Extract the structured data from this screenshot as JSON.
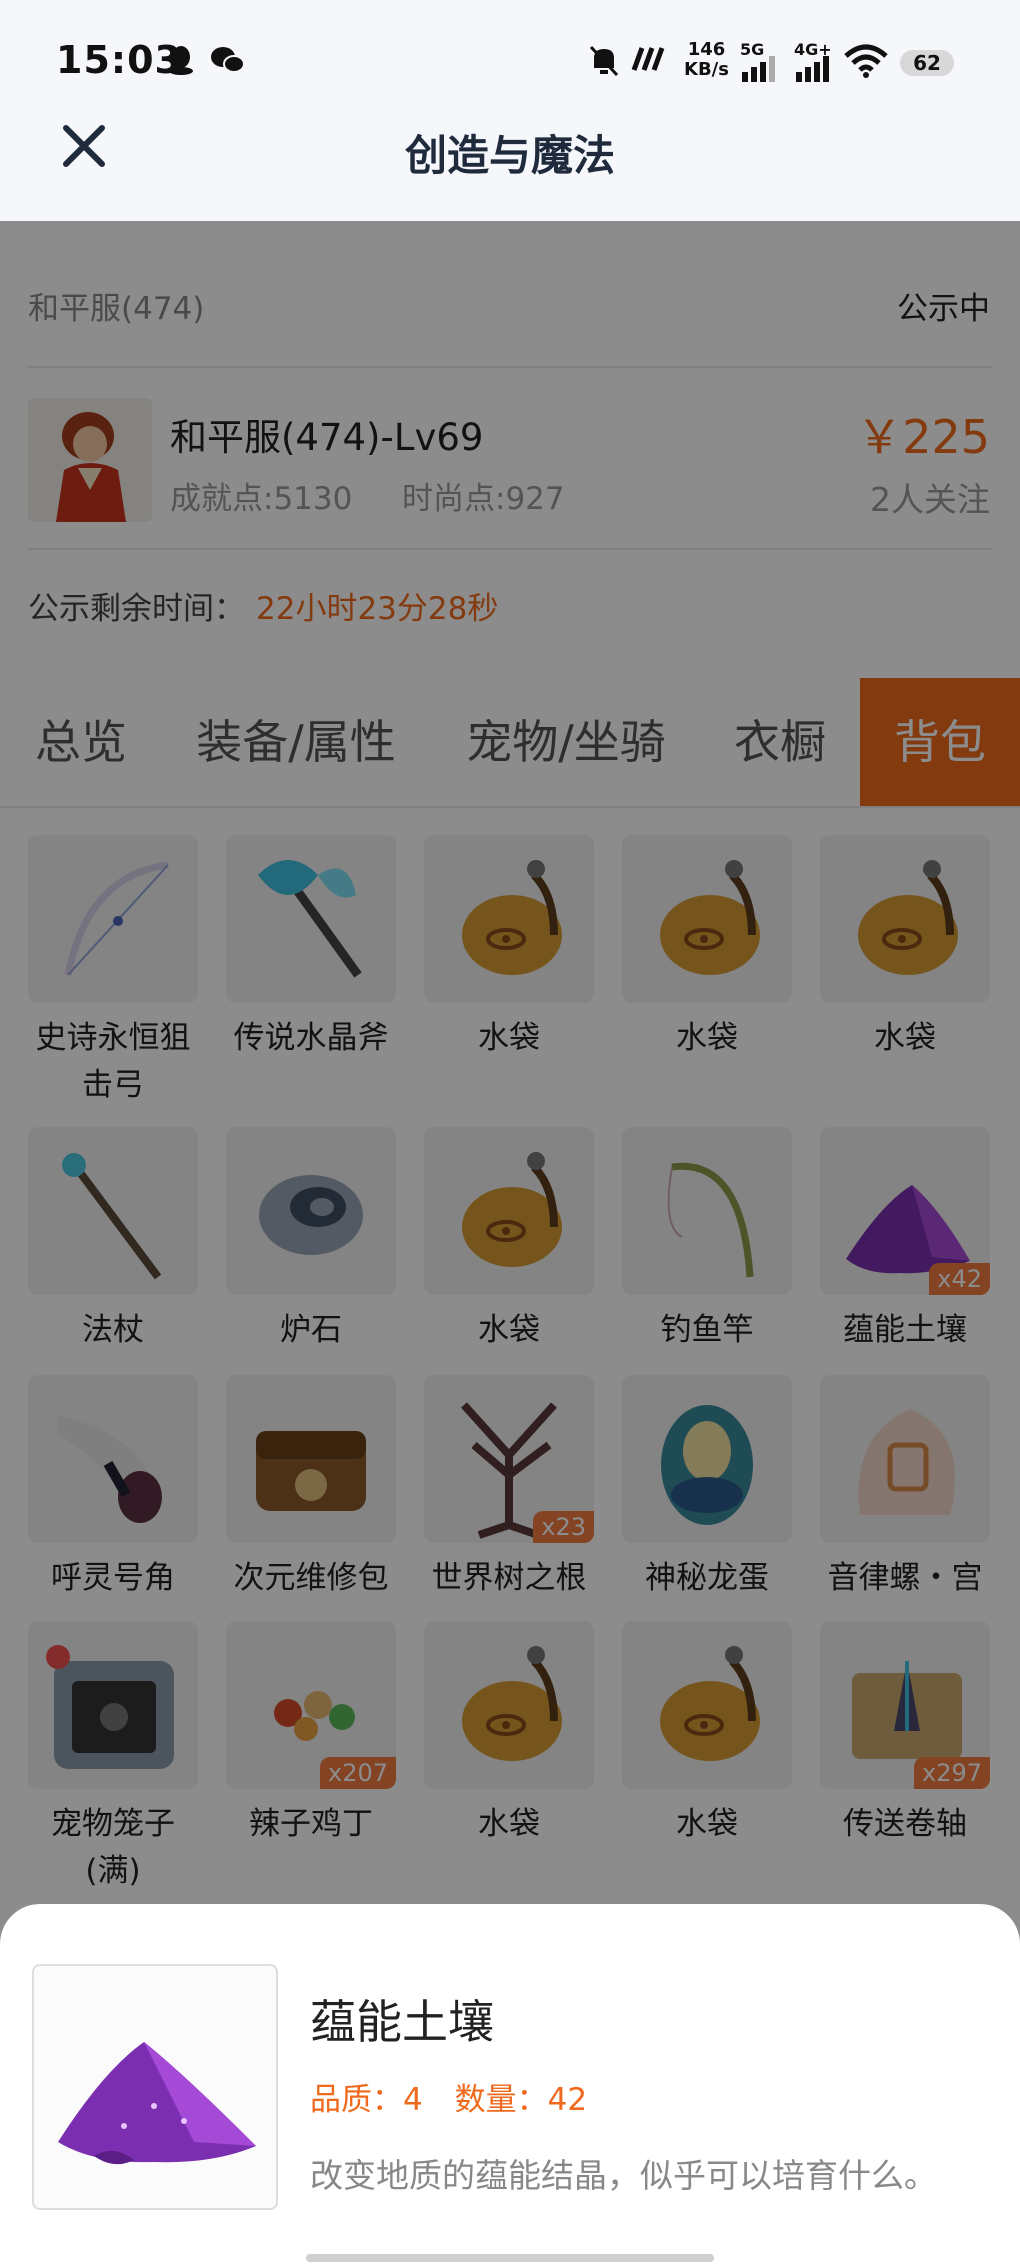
{
  "status_bar": {
    "time": "15:03",
    "speed_value": "146",
    "speed_unit": "KB/s",
    "net1": "5G",
    "net2": "4G+",
    "battery": "62",
    "icons": [
      "qq-icon",
      "wechat-icon",
      "mute-bell-icon",
      "nfc-icon",
      "signal-icon",
      "wifi-icon"
    ]
  },
  "nav": {
    "title": "创造与魔法",
    "close_icon": "close-icon"
  },
  "server": {
    "name": "和平服(474)",
    "status": "公示中"
  },
  "character": {
    "name": "和平服(474)-Lv69",
    "achievement": "成就点:5130",
    "fashion": "时尚点:927",
    "price": "￥225",
    "followers": "2人关注"
  },
  "countdown": {
    "label": "公示剩余时间：",
    "value": "22小时23分28秒"
  },
  "tabs": [
    {
      "label": "总览"
    },
    {
      "label": "装备/属性"
    },
    {
      "label": "宠物/坐骑"
    },
    {
      "label": "衣橱"
    },
    {
      "label": "背包"
    }
  ],
  "items": [
    {
      "name": "史诗永恒狙击弓",
      "icon": "bow-icon",
      "count": ""
    },
    {
      "name": "传说水晶斧",
      "icon": "crystal-axe-icon",
      "count": ""
    },
    {
      "name": "水袋",
      "icon": "water-bag-icon",
      "count": ""
    },
    {
      "name": "水袋",
      "icon": "water-bag-icon",
      "count": ""
    },
    {
      "name": "水袋",
      "icon": "water-bag-icon",
      "count": ""
    },
    {
      "name": "法杖",
      "icon": "staff-icon",
      "count": ""
    },
    {
      "name": "炉石",
      "icon": "hearthstone-icon",
      "count": ""
    },
    {
      "name": "水袋",
      "icon": "water-bag-icon",
      "count": ""
    },
    {
      "name": "钓鱼竿",
      "icon": "fishing-rod-icon",
      "count": ""
    },
    {
      "name": "蕴能土壤",
      "icon": "purple-soil-icon",
      "count": "x42"
    },
    {
      "name": "呼灵号角",
      "icon": "horn-icon",
      "count": ""
    },
    {
      "name": "次元维修包",
      "icon": "repair-bag-icon",
      "count": ""
    },
    {
      "name": "世界树之根",
      "icon": "tree-root-icon",
      "count": "x23"
    },
    {
      "name": "神秘龙蛋",
      "icon": "dragon-egg-icon",
      "count": ""
    },
    {
      "name": "音律螺・宫",
      "icon": "conch-icon",
      "count": ""
    },
    {
      "name": "宠物笼子(满)",
      "icon": "pet-cage-icon",
      "count": ""
    },
    {
      "name": "辣子鸡丁",
      "icon": "food-plate-icon",
      "count": "x207"
    },
    {
      "name": "水袋",
      "icon": "water-bag-icon",
      "count": ""
    },
    {
      "name": "水袋",
      "icon": "water-bag-icon",
      "count": ""
    },
    {
      "name": "传送卷轴",
      "icon": "teleport-scroll-icon",
      "count": "x297"
    }
  ],
  "detail": {
    "name": "蕴能土壤",
    "quality": "品质：4",
    "quantity": "数量：42",
    "description": "改变地质的蕴能结晶，似乎可以培育什么。"
  },
  "colors": {
    "accent": "#f06a1d",
    "overlay": "rgba(0,0,0,0.45)"
  }
}
